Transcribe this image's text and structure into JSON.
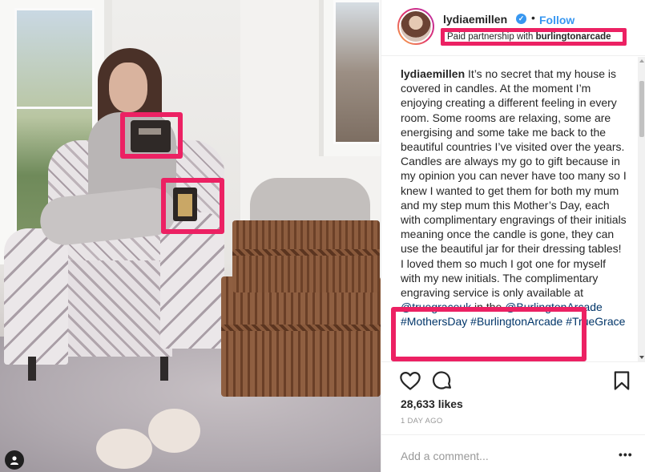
{
  "post": {
    "username": "lydiaemillen",
    "verified_icon": "verified-badge-icon",
    "separator": "•",
    "follow_label": "Follow",
    "paid_prefix": "Paid partnership with",
    "paid_partner": "burlingtonarcade",
    "caption_author": "lydiaemillen",
    "caption_text": "It’s no secret that my house is covered in candles. At the moment I’m enjoying creating a different feeling in every room. Some rooms are relaxing, some are energising and some take me back to the beautiful countries I’ve visited over the years. Candles are always my go to gift because in my opinion you can never have too many so I knew I wanted to get them for both my mum and my step mum this Mother’s Day, each with complimentary engravings of their initials meaning once the candle is gone, they can use the beautiful jar for their dressing tables! I loved them so much I got one for myself with my new initials. The complimentary engraving service is only available at",
    "mention_1": "@truegraceuk",
    "text_in_the": "in the",
    "mention_2": "@BurlingtonArcade",
    "hashtag_1": "#MothersDay",
    "hashtag_2": "#BurlingtonArcade",
    "hashtag_3": "#TrueGrace",
    "likes": "28,633 likes",
    "time_ago": "1 DAY AGO",
    "comment_placeholder": "Add a comment...",
    "more_label": "•••"
  },
  "icons": {
    "like": "heart-icon",
    "comment": "comment-bubble-icon",
    "save": "bookmark-icon",
    "tagged_user": "user-tag-icon"
  },
  "colors": {
    "highlight": "#ec2163",
    "link": "#003569",
    "follow": "#3897f0",
    "muted": "#999999"
  }
}
